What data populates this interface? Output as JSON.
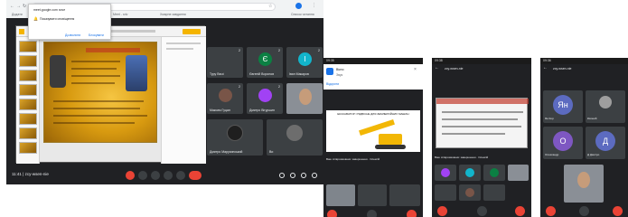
{
  "browser": {
    "url": "meet.google.com/dcs-moza-hre",
    "bookmarks": [
      "Додати",
      "Meet - xdv",
      "Навчання",
      "",
      "Хмарне завдання",
      "",
      "",
      "Список читання"
    ],
    "popup": {
      "line1": "meet.google.com хоче",
      "line2": "Показувати сповіщення",
      "allow": "Дозволити",
      "block": "Блокувати"
    }
  },
  "shared_screen": {
    "app": "presentation"
  },
  "participants": [
    {
      "name": "Туру Вюзі",
      "initial": "",
      "color": "#3c4043",
      "count": "2"
    },
    {
      "name": "Євгеній Воронов",
      "initial": "Є",
      "color": "#0b8043",
      "count": "2"
    },
    {
      "name": "Іван Макаров",
      "initial": "І",
      "color": "#12b5cb",
      "count": "2"
    },
    {
      "name": "Максим Гуцал",
      "initial": "",
      "color": "#795548",
      "count": "2"
    },
    {
      "name": "Дмитро Вігуршин",
      "initial": "",
      "color": "#a142f4",
      "count": "2"
    },
    {
      "name": "",
      "initial": "",
      "color": "#5f6368",
      "count": ""
    },
    {
      "name": "Дмитро Марусинський",
      "initial": "",
      "color": "#3c4043",
      "count": ""
    },
    {
      "name": "Ви",
      "initial": "",
      "color": "#3c4043",
      "count": ""
    }
  ],
  "meeting": {
    "time_code": "11:41 | zcy-wsen-nie"
  },
  "phone1": {
    "status": "09:35",
    "title": "Вікно",
    "subtitle": "Звук",
    "link": "Відкрити",
    "slide_caption": "ЕКСКАВАТОР І ПІДВІСНЕ ДЛЯ ЗЕМЛЕРИЙНИХ МАШИН",
    "caption": "Ваш співрозмовник: завершення · Олексій"
  },
  "phone2": {
    "status": "09:38",
    "title": "zcy-wsen-nie",
    "caption": "Ваш співрозмовник: завершення · Олексій"
  },
  "phone3": {
    "status": "09:36",
    "title": "zcy-wsen-nie",
    "tiles": [
      {
        "initial": "Ян",
        "color": "#5c6bc0"
      },
      {
        "initial": "",
        "color": "#3c4043"
      },
      {
        "initial": "О",
        "color": "#7e57c2"
      },
      {
        "initial": "Д",
        "color": "#5c6bc0"
      }
    ],
    "names": [
      "Ян Кор",
      "Євгеній",
      "Олександр",
      "Д Дмитро"
    ]
  }
}
